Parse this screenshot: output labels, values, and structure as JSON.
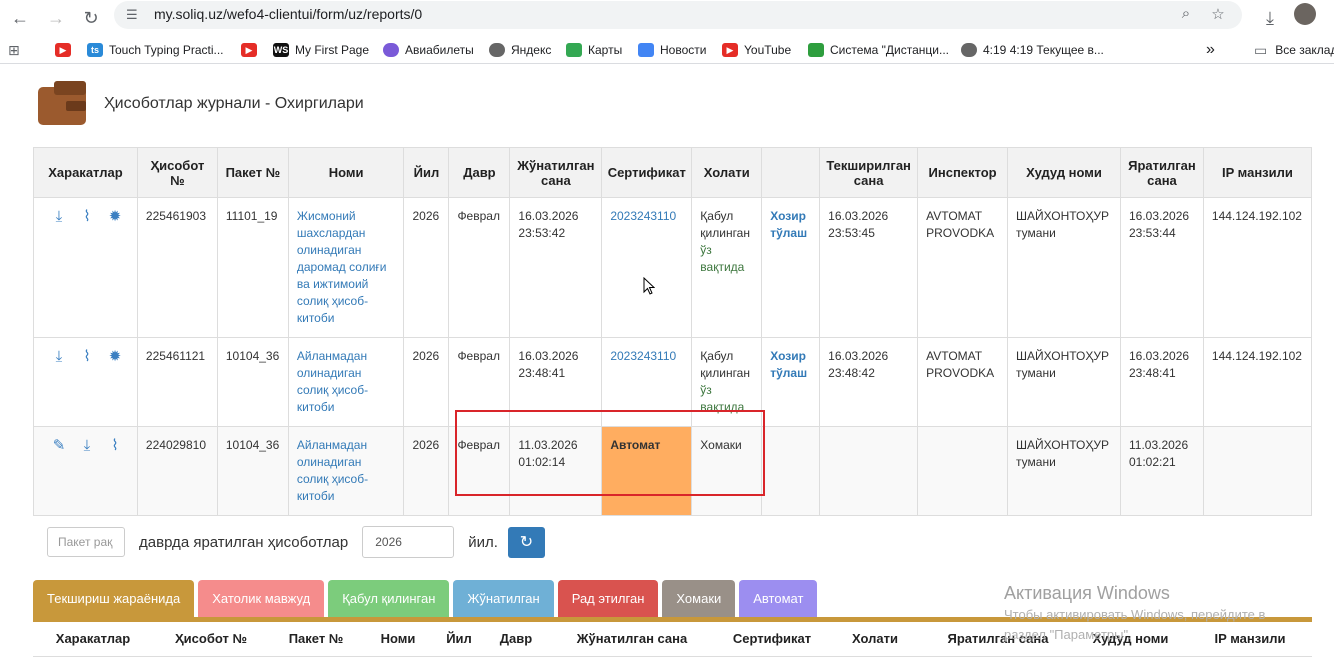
{
  "browser": {
    "url": "my.soliq.uz/wefo4-clientui/form/uz/reports/0",
    "bookmarks": [
      {
        "label": "",
        "icon": "youtube-icon"
      },
      {
        "label": "Touch Typing Practi...",
        "icon": "ts-icon"
      },
      {
        "label": "",
        "icon": "youtube-icon"
      },
      {
        "label": "My First Page",
        "icon": "ws-icon"
      },
      {
        "label": "Авиабилеты",
        "icon": "globe-icon"
      },
      {
        "label": "Яндекс",
        "icon": "globe-icon"
      },
      {
        "label": "Карты",
        "icon": "maps-icon"
      },
      {
        "label": "Новости",
        "icon": "news-icon"
      },
      {
        "label": "YouTube",
        "icon": "youtube-icon"
      },
      {
        "label": "Система \"Дистанци...",
        "icon": "green-icon"
      },
      {
        "label": "4:19 4:19 Текущее в...",
        "icon": "globe-icon"
      }
    ],
    "bookmarks_more": "»",
    "all_bookmarks": "Все заклад"
  },
  "page": {
    "title": "Ҳисоботлар журнали - Охиргилари"
  },
  "table": {
    "headers": {
      "actions": "Харакатлар",
      "report_no": "Ҳисобот №",
      "package_no": "Пакет №",
      "name": "Номи",
      "year": "Йил",
      "period": "Давр",
      "sent_date": "Жўнатилган сана",
      "certificate": "Сертификат",
      "status": "Холати",
      "checked_date": "Текширилган сана",
      "inspector": "Инспектор",
      "region": "Худуд номи",
      "created_date": "Яратилган сана",
      "ip": "IP манзили"
    },
    "rows": [
      {
        "report_no": "225461903",
        "package_no": "11101_19",
        "name": "Жисмоний шахслардан олинадиган даромад солиғи ва ижтимоий солиқ ҳисоб-китоби",
        "year": "2026",
        "period": "Феврал",
        "sent_date": "16.03.2026 23:53:42",
        "certificate": "2023243110",
        "status": "Қабул қилинган",
        "status_note": "ўз вақтида",
        "pay": "Хозир тўлаш",
        "checked_date": "16.03.2026 23:53:45",
        "inspector": "AVTOMAT PROVODKA",
        "region": "ШАЙХОНТОҲУР тумани",
        "created_date": "16.03.2026 23:53:44",
        "ip": "144.124.192.102"
      },
      {
        "report_no": "225461121",
        "package_no": "10104_36",
        "name": "Айланмадан олинадиган солиқ ҳисоб-китоби",
        "year": "2026",
        "period": "Феврал",
        "sent_date": "16.03.2026 23:48:41",
        "certificate": "2023243110",
        "status": "Қабул қилинган",
        "status_note": "ўз вақтида",
        "pay": "Хозир тўлаш",
        "checked_date": "16.03.2026 23:48:42",
        "inspector": "AVTOMAT PROVODKA",
        "region": "ШАЙХОНТОҲУР тумани",
        "created_date": "16.03.2026 23:48:41",
        "ip": "144.124.192.102"
      },
      {
        "report_no": "224029810",
        "package_no": "10104_36",
        "name": "Айланмадан олинадиган солиқ ҳисоб-китоби",
        "year": "2026",
        "period": "Феврал",
        "sent_date": "11.03.2026 01:02:14",
        "certificate": "Автомат",
        "status": "Хомаки",
        "region": "ШАЙХОНТОҲУР тумани",
        "created_date": "11.03.2026 01:02:21"
      }
    ]
  },
  "filter": {
    "package_placeholder": "Пакет рақ",
    "label": "даврда яратилган ҳисоботлар",
    "year_value": "2026",
    "year_suffix": "йил."
  },
  "tabs": [
    {
      "label": "Текшириш жараёнида",
      "color": "#c8983b"
    },
    {
      "label": "Хатолик мавжуд",
      "color": "#f58c8c"
    },
    {
      "label": "Қабул қилинган",
      "color": "#7ccc7c"
    },
    {
      "label": "Жўнатилган",
      "color": "#6fb0d6"
    },
    {
      "label": "Рад этилган",
      "color": "#d9534f"
    },
    {
      "label": "Хомаки",
      "color": "#999088"
    },
    {
      "label": "Автомат",
      "color": "#9c8ef0"
    }
  ],
  "bottom_headers": [
    "Харакатлар",
    "Ҳисобот №",
    "Пакет №",
    "Номи",
    "Йил",
    "Давр",
    "Жўнатилган сана",
    "Сертификат",
    "Холати",
    "Яратилган сана",
    "Худуд номи",
    "IP манзили"
  ],
  "watermark": {
    "line1": "Активация Windows",
    "line2": "Чтобы активировать Windows, перейдите в",
    "line3": "раздел \"Параметры\"."
  }
}
